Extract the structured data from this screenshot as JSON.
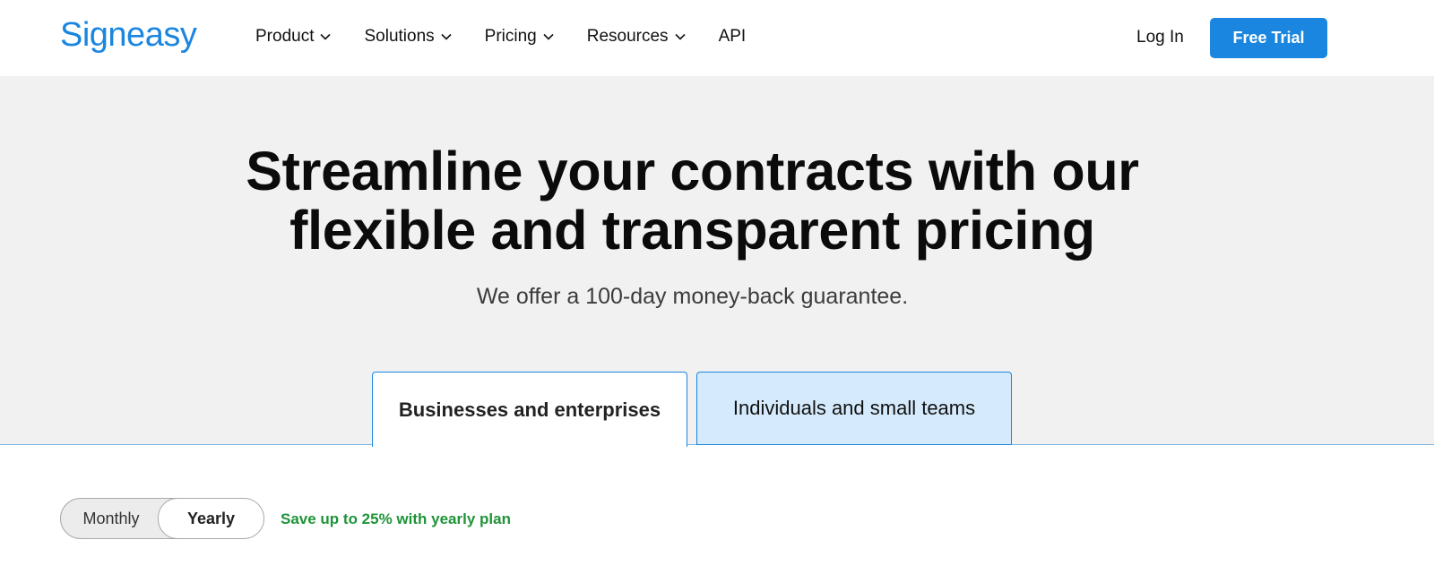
{
  "header": {
    "logo": "Signeasy",
    "nav": [
      {
        "label": "Product",
        "has_dropdown": true
      },
      {
        "label": "Solutions",
        "has_dropdown": true
      },
      {
        "label": "Pricing",
        "has_dropdown": true
      },
      {
        "label": "Resources",
        "has_dropdown": true
      },
      {
        "label": "API",
        "has_dropdown": false
      }
    ],
    "login_label": "Log In",
    "trial_label": "Free Trial"
  },
  "hero": {
    "title_line1": "Streamline your contracts with our",
    "title_line2": "flexible and transparent pricing",
    "subtitle": "We offer a 100-day money-back guarantee."
  },
  "tabs": {
    "items": [
      {
        "label": "Businesses and enterprises",
        "selected": true
      },
      {
        "label": "Individuals and small teams",
        "selected": false
      }
    ]
  },
  "billing": {
    "options": [
      "Monthly",
      "Yearly"
    ],
    "selected": "Yearly",
    "save_note": "Save up to 25% with yearly plan"
  },
  "colors": {
    "brand": "#1a86e0",
    "hero_bg": "#f1f1f1",
    "tab_inactive_bg": "#d5eafc",
    "save_green": "#1f9438"
  }
}
